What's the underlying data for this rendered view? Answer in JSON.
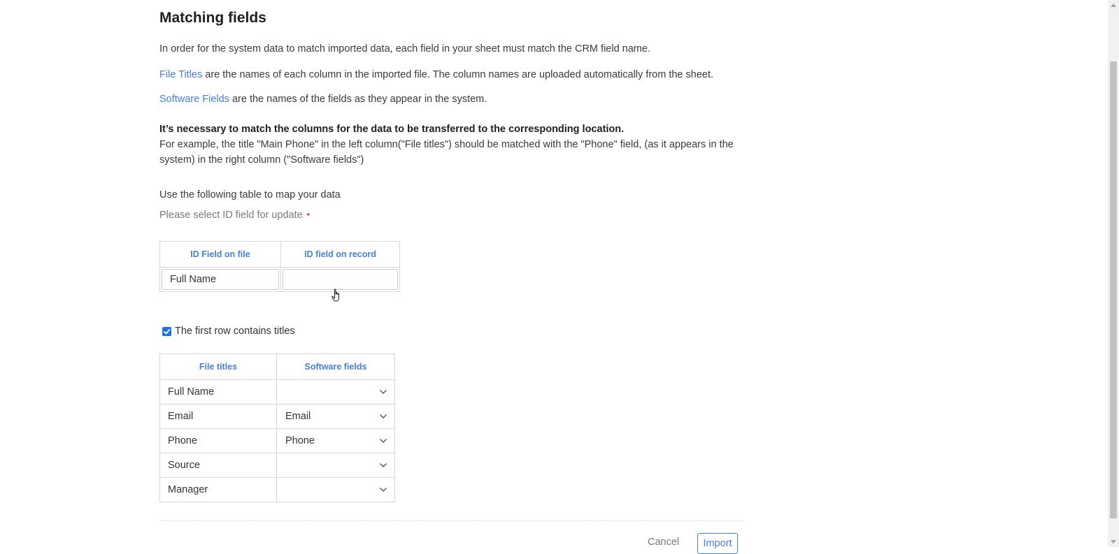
{
  "page": {
    "title": "Matching fields",
    "intro": "In order for the system data to match imported data, each field in your sheet must match the CRM field name.",
    "file_titles_link": "File Titles",
    "file_titles_desc": " are the names of each column in the imported file. The column names are uploaded automatically from the sheet.",
    "software_fields_link": "Software Fields",
    "software_fields_desc": " are the names of the fields as they appear in the system.",
    "important_note": "It’s necessary to match the columns for the data to be transferred to the corresponding location.",
    "example_text": "For example, the title \"Main Phone\" in the left column(\"File titles\") should be matched with the \"Phone\" field, (as it appears in the system) in the right column (\"Software fields\")",
    "map_instruction": "Use the following table to map your data",
    "id_select_instruction": "Please select ID field for update",
    "required_marker": "•"
  },
  "id_table": {
    "headers": [
      "ID Field on file",
      "ID field on record"
    ],
    "file_value": "Full Name",
    "record_value": ""
  },
  "first_row_titles": {
    "label": "The first row contains titles",
    "checked": true
  },
  "mapping_table": {
    "headers": [
      "File titles",
      "Software fields"
    ],
    "rows": [
      {
        "file_title": "Full Name",
        "software_field": ""
      },
      {
        "file_title": "Email",
        "software_field": "Email"
      },
      {
        "file_title": "Phone",
        "software_field": "Phone"
      },
      {
        "file_title": "Source",
        "software_field": ""
      },
      {
        "file_title": "Manager",
        "software_field": ""
      }
    ]
  },
  "actions": {
    "cancel_label": "Cancel",
    "import_label": "Import"
  },
  "colors": {
    "link": "#4a7fd0",
    "header_blue": "#4a92d6",
    "required": "#d42a2a",
    "checkbox": "#1a73e8"
  }
}
